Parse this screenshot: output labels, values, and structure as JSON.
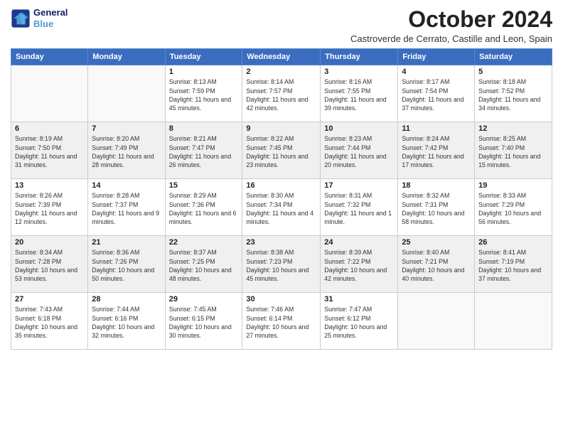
{
  "header": {
    "logo_line1": "General",
    "logo_line2": "Blue",
    "title": "October 2024",
    "subtitle": "Castroverde de Cerrato, Castille and Leon, Spain"
  },
  "columns": [
    "Sunday",
    "Monday",
    "Tuesday",
    "Wednesday",
    "Thursday",
    "Friday",
    "Saturday"
  ],
  "weeks": [
    [
      {
        "day": "",
        "info": ""
      },
      {
        "day": "",
        "info": ""
      },
      {
        "day": "1",
        "info": "Sunrise: 8:13 AM\nSunset: 7:59 PM\nDaylight: 11 hours and 45 minutes."
      },
      {
        "day": "2",
        "info": "Sunrise: 8:14 AM\nSunset: 7:57 PM\nDaylight: 11 hours and 42 minutes."
      },
      {
        "day": "3",
        "info": "Sunrise: 8:16 AM\nSunset: 7:55 PM\nDaylight: 11 hours and 39 minutes."
      },
      {
        "day": "4",
        "info": "Sunrise: 8:17 AM\nSunset: 7:54 PM\nDaylight: 11 hours and 37 minutes."
      },
      {
        "day": "5",
        "info": "Sunrise: 8:18 AM\nSunset: 7:52 PM\nDaylight: 11 hours and 34 minutes."
      }
    ],
    [
      {
        "day": "6",
        "info": "Sunrise: 8:19 AM\nSunset: 7:50 PM\nDaylight: 11 hours and 31 minutes."
      },
      {
        "day": "7",
        "info": "Sunrise: 8:20 AM\nSunset: 7:49 PM\nDaylight: 11 hours and 28 minutes."
      },
      {
        "day": "8",
        "info": "Sunrise: 8:21 AM\nSunset: 7:47 PM\nDaylight: 11 hours and 26 minutes."
      },
      {
        "day": "9",
        "info": "Sunrise: 8:22 AM\nSunset: 7:45 PM\nDaylight: 11 hours and 23 minutes."
      },
      {
        "day": "10",
        "info": "Sunrise: 8:23 AM\nSunset: 7:44 PM\nDaylight: 11 hours and 20 minutes."
      },
      {
        "day": "11",
        "info": "Sunrise: 8:24 AM\nSunset: 7:42 PM\nDaylight: 11 hours and 17 minutes."
      },
      {
        "day": "12",
        "info": "Sunrise: 8:25 AM\nSunset: 7:40 PM\nDaylight: 11 hours and 15 minutes."
      }
    ],
    [
      {
        "day": "13",
        "info": "Sunrise: 8:26 AM\nSunset: 7:39 PM\nDaylight: 11 hours and 12 minutes."
      },
      {
        "day": "14",
        "info": "Sunrise: 8:28 AM\nSunset: 7:37 PM\nDaylight: 11 hours and 9 minutes."
      },
      {
        "day": "15",
        "info": "Sunrise: 8:29 AM\nSunset: 7:36 PM\nDaylight: 11 hours and 6 minutes."
      },
      {
        "day": "16",
        "info": "Sunrise: 8:30 AM\nSunset: 7:34 PM\nDaylight: 11 hours and 4 minutes."
      },
      {
        "day": "17",
        "info": "Sunrise: 8:31 AM\nSunset: 7:32 PM\nDaylight: 11 hours and 1 minute."
      },
      {
        "day": "18",
        "info": "Sunrise: 8:32 AM\nSunset: 7:31 PM\nDaylight: 10 hours and 58 minutes."
      },
      {
        "day": "19",
        "info": "Sunrise: 8:33 AM\nSunset: 7:29 PM\nDaylight: 10 hours and 56 minutes."
      }
    ],
    [
      {
        "day": "20",
        "info": "Sunrise: 8:34 AM\nSunset: 7:28 PM\nDaylight: 10 hours and 53 minutes."
      },
      {
        "day": "21",
        "info": "Sunrise: 8:36 AM\nSunset: 7:26 PM\nDaylight: 10 hours and 50 minutes."
      },
      {
        "day": "22",
        "info": "Sunrise: 8:37 AM\nSunset: 7:25 PM\nDaylight: 10 hours and 48 minutes."
      },
      {
        "day": "23",
        "info": "Sunrise: 8:38 AM\nSunset: 7:23 PM\nDaylight: 10 hours and 45 minutes."
      },
      {
        "day": "24",
        "info": "Sunrise: 8:39 AM\nSunset: 7:22 PM\nDaylight: 10 hours and 42 minutes."
      },
      {
        "day": "25",
        "info": "Sunrise: 8:40 AM\nSunset: 7:21 PM\nDaylight: 10 hours and 40 minutes."
      },
      {
        "day": "26",
        "info": "Sunrise: 8:41 AM\nSunset: 7:19 PM\nDaylight: 10 hours and 37 minutes."
      }
    ],
    [
      {
        "day": "27",
        "info": "Sunrise: 7:43 AM\nSunset: 6:18 PM\nDaylight: 10 hours and 35 minutes."
      },
      {
        "day": "28",
        "info": "Sunrise: 7:44 AM\nSunset: 6:16 PM\nDaylight: 10 hours and 32 minutes."
      },
      {
        "day": "29",
        "info": "Sunrise: 7:45 AM\nSunset: 6:15 PM\nDaylight: 10 hours and 30 minutes."
      },
      {
        "day": "30",
        "info": "Sunrise: 7:46 AM\nSunset: 6:14 PM\nDaylight: 10 hours and 27 minutes."
      },
      {
        "day": "31",
        "info": "Sunrise: 7:47 AM\nSunset: 6:12 PM\nDaylight: 10 hours and 25 minutes."
      },
      {
        "day": "",
        "info": ""
      },
      {
        "day": "",
        "info": ""
      }
    ]
  ]
}
